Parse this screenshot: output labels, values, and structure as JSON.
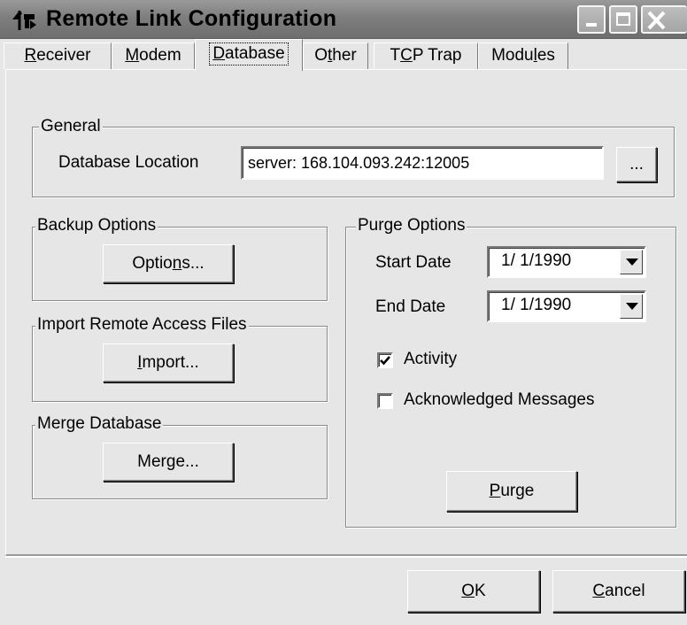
{
  "window": {
    "title": "Remote Link Configuration",
    "controls": {
      "minimize": "minimize-icon",
      "maximize": "maximize-icon",
      "close": "close-icon"
    }
  },
  "tabs": [
    {
      "label": "Receiver",
      "mnemonic": "R",
      "rest": "eceiver"
    },
    {
      "label": "Modem",
      "mnemonic": "M",
      "rest": "odem"
    },
    {
      "label": "Database",
      "mnemonic": "D",
      "rest": "atabase",
      "active": true
    },
    {
      "label": "Other",
      "pre": "O",
      "mnemonic": "t",
      "rest": "her"
    },
    {
      "label": "TCP Trap",
      "pre": "T",
      "mnemonic": "C",
      "rest": "P Trap"
    },
    {
      "label": "Modules",
      "pre": "Modu",
      "mnemonic": "l",
      "rest": "es"
    }
  ],
  "general": {
    "legend": "General",
    "db_location_label": "Database Location",
    "db_location_value": "server: 168.104.093.242:12005",
    "browse_label": "..."
  },
  "backup": {
    "legend": "Backup Options",
    "button_pre": "Optio",
    "button_mnemonic": "n",
    "button_rest": "s..."
  },
  "import": {
    "legend": "Import Remote Access Files",
    "button_mnemonic": "I",
    "button_rest": "mport..."
  },
  "merge": {
    "legend": "Merge Database",
    "button_pre": "Mer",
    "button_mnemonic": "g",
    "button_rest": "e..."
  },
  "purge": {
    "legend": "Purge Options",
    "start_label": "Start Date",
    "start_value": "1/ 1/1990",
    "end_label": "End Date",
    "end_value": "1/ 1/1990",
    "activity_label": "Activity",
    "activity_checked": true,
    "ack_label": "Acknowledged Messages",
    "ack_checked": false,
    "button_mnemonic": "P",
    "button_rest": "urge"
  },
  "footer": {
    "ok_mnemonic": "O",
    "ok_rest": "K",
    "cancel_mnemonic": "C",
    "cancel_rest": "ancel"
  }
}
